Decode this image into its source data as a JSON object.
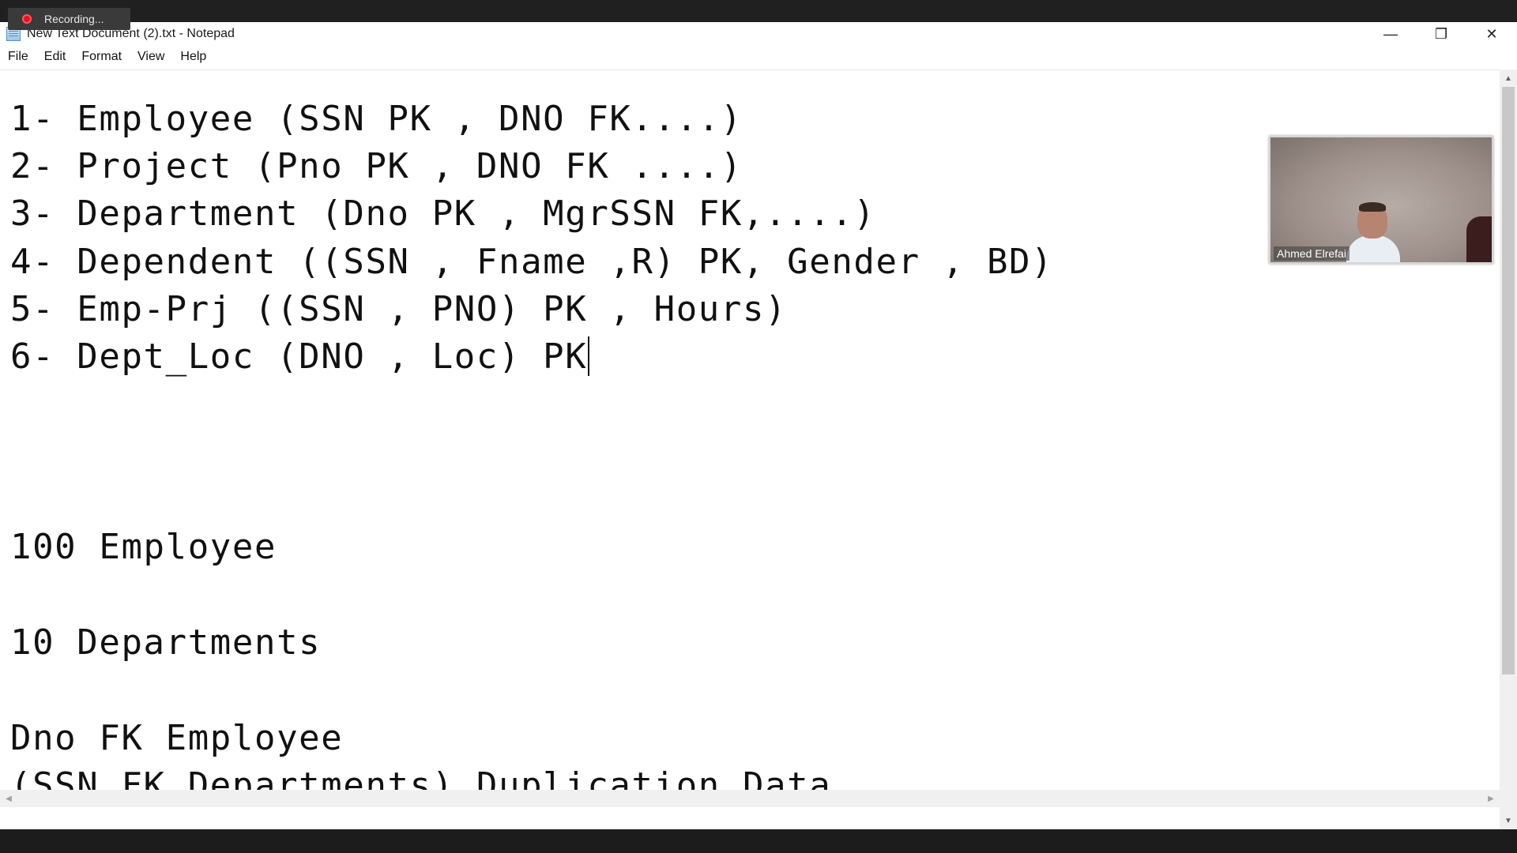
{
  "recording": {
    "label": "Recording..."
  },
  "window": {
    "title": "New Text Document (2).txt - Notepad",
    "controls": {
      "minimize": "—",
      "restore": "❐",
      "close": "✕"
    }
  },
  "menu": {
    "items": [
      "File",
      "Edit",
      "Format",
      "View",
      "Help"
    ]
  },
  "document": {
    "lines": [
      "1- Employee (SSN PK , DNO FK....)",
      "2- Project (Pno PK , DNO FK ....)",
      "3- Department (Dno PK , MgrSSN FK,....)",
      "4- Dependent ((SSN , Fname ,R) PK, Gender , BD)",
      "5- Emp-Prj ((SSN , PNO) PK , Hours)",
      "6- Dept_Loc (DNO , Loc) PK",
      "100 Employee",
      "10 Departments",
      "Dno FK Employee",
      "(SSN FK Departments) Duplication Data"
    ]
  },
  "webcam": {
    "participant_name": "Ahmed Elrefai"
  },
  "icons": {
    "app": "notepad-icon",
    "recording": "record-dot-icon",
    "scroll_up": "▲",
    "scroll_down": "▼",
    "scroll_left": "◀",
    "scroll_right": "▶"
  }
}
